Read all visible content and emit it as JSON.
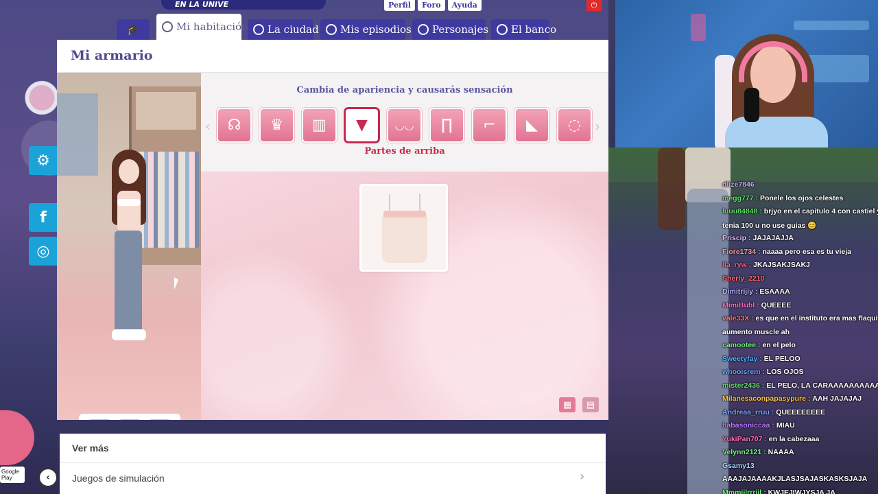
{
  "banner": {
    "text": "EN LA UNIVE"
  },
  "top_links": [
    "Perfil",
    "Foro",
    "Ayuda"
  ],
  "nav": {
    "home_icon": "graduation-cap-icon",
    "tabs": [
      {
        "label": "Mi habitación",
        "icon": "room-icon",
        "active": true
      },
      {
        "label": "La ciudad",
        "icon": "location-pin-icon",
        "active": false
      },
      {
        "label": "Mis episodios",
        "icon": "play-icon",
        "active": false
      },
      {
        "label": "Personajes",
        "icon": "heart-icon",
        "active": false
      },
      {
        "label": "El banco",
        "icon": "coin-icon",
        "active": false
      }
    ]
  },
  "panel": {
    "title": "Mi armario",
    "category_heading": "Cambia de apariencia y causarás sensación",
    "selected_caption": "Partes de arriba",
    "categories": [
      {
        "name": "hair",
        "icon": "hair-icon",
        "glyph": "☊"
      },
      {
        "name": "hats",
        "icon": "hat-icon",
        "glyph": "♛"
      },
      {
        "name": "jackets",
        "icon": "jacket-icon",
        "glyph": "▥"
      },
      {
        "name": "tops",
        "icon": "top-icon",
        "glyph": "▼",
        "active": true
      },
      {
        "name": "underwear",
        "icon": "bra-icon",
        "glyph": "◡◡"
      },
      {
        "name": "pants",
        "icon": "pants-icon",
        "glyph": "∏"
      },
      {
        "name": "socks",
        "icon": "sock-icon",
        "glyph": "⌐"
      },
      {
        "name": "shoes",
        "icon": "boot-icon",
        "glyph": "◣"
      },
      {
        "name": "accessories",
        "icon": "necklace-icon",
        "glyph": "◌"
      }
    ],
    "items": [
      {
        "name": "cream-lace-camisole"
      }
    ],
    "actions": [
      {
        "name": "face-button",
        "icon": "face-icon",
        "glyph": "☺"
      },
      {
        "name": "reset-button",
        "icon": "refresh-icon",
        "glyph": "⟳"
      },
      {
        "name": "save-button",
        "icon": "save-icon",
        "glyph": "▣"
      }
    ]
  },
  "social": [
    {
      "name": "settings",
      "icon": "gear-icon",
      "glyph": "⚙"
    },
    {
      "name": "facebook",
      "icon": "facebook-icon",
      "glyph": "f"
    },
    {
      "name": "instagram",
      "icon": "instagram-icon",
      "glyph": "◎"
    }
  ],
  "ver_mas": {
    "title": "Ver más",
    "row": "Juegos de simulación"
  },
  "google_play": "Google Play",
  "chat": [
    {
      "user": "dlize7846",
      "text": "",
      "color": "#c7a6ff"
    },
    {
      "user": "megg777",
      "text": "Ponele los ojos celestes",
      "color": "#5fe06a"
    },
    {
      "user": "luuu84848",
      "text": "brjyo en el capitulo 4 con castiel y",
      "color": "#5fe06a"
    },
    {
      "user": "",
      "text": "tenia 100 u no use guias 😊",
      "color": "#ffffff"
    },
    {
      "user": "Priscip",
      "text": "JAJAJAJJA",
      "color": "#e7b8ff"
    },
    {
      "user": "Fiore1734",
      "text": "naaaa pero esa es tu vieja",
      "color": "#ff9b9b"
    },
    {
      "user": "lla_ryw",
      "text": "JKAJSAKJSAKJ",
      "color": "#ff5c8a"
    },
    {
      "user": "Sherly_2210",
      "text": "",
      "color": "#ff6b6b"
    },
    {
      "user": "Dimitrijiy",
      "text": "ESAAAA",
      "color": "#b9b9ff"
    },
    {
      "user": "MimiBubl",
      "text": "QUEEEE",
      "color": "#ff6bd0"
    },
    {
      "user": "vale33X",
      "text": "es que en el instituto era mas flaquita",
      "color": "#ff7a7a"
    },
    {
      "user": "",
      "text": "aumento muscle ah",
      "color": "#ffffff"
    },
    {
      "user": "camootee",
      "text": "en el pelo",
      "color": "#6ff27a"
    },
    {
      "user": "Sweetyfay",
      "text": "EL PELOO",
      "color": "#4db5ff"
    },
    {
      "user": "whooisrem",
      "text": "LOS OJOS",
      "color": "#6aa6ff"
    },
    {
      "user": "mister2436",
      "text": "EL PELO, LA CARAAAAAAAAAA",
      "color": "#5fe06a"
    },
    {
      "user": "Milanesaconpapasypure",
      "text": "AAH JAJAJAJ",
      "color": "#ffc247"
    },
    {
      "user": "Andreaa_rruu",
      "text": "QUEEEEEEEE",
      "color": "#7aa7ff"
    },
    {
      "user": "babasoniccaa",
      "text": "MIAU",
      "color": "#c07bff"
    },
    {
      "user": "YukiPan707",
      "text": "en la cabezaaa",
      "color": "#ff6bb0"
    },
    {
      "user": "Velynn2121",
      "text": "NAAAA",
      "color": "#6ff27a"
    },
    {
      "user": "Gsamy13",
      "text": "",
      "color": "#b0d8ff"
    },
    {
      "user": "",
      "text": "AAAJAJAAAAKJLASJSAJASKASKSJAJA",
      "color": "#ffffff"
    },
    {
      "user": "Mmmiilrrriil",
      "text": "KWJEJIWJYSJA JA",
      "color": "#6ff27a"
    }
  ]
}
